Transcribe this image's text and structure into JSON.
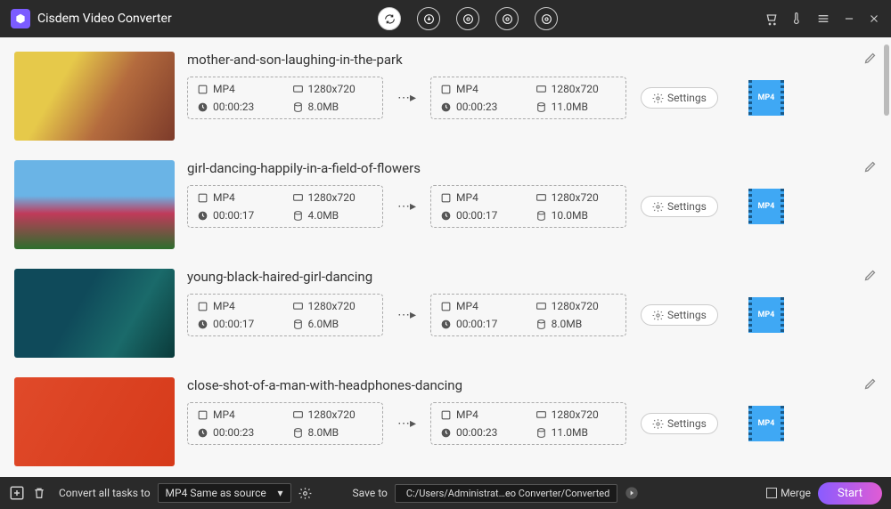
{
  "appTitle": "Cisdem Video Converter",
  "settingsLabel": "Settings",
  "formatBadge": "MP4",
  "items": [
    {
      "title": "mother-and-son-laughing-in-the-park",
      "src": {
        "format": "MP4",
        "res": "1280x720",
        "dur": "00:00:23",
        "size": "8.0MB"
      },
      "dst": {
        "format": "MP4",
        "res": "1280x720",
        "dur": "00:00:23",
        "size": "11.0MB"
      }
    },
    {
      "title": "girl-dancing-happily-in-a-field-of-flowers",
      "src": {
        "format": "MP4",
        "res": "1280x720",
        "dur": "00:00:17",
        "size": "4.0MB"
      },
      "dst": {
        "format": "MP4",
        "res": "1280x720",
        "dur": "00:00:17",
        "size": "10.0MB"
      }
    },
    {
      "title": "young-black-haired-girl-dancing",
      "src": {
        "format": "MP4",
        "res": "1280x720",
        "dur": "00:00:17",
        "size": "6.0MB"
      },
      "dst": {
        "format": "MP4",
        "res": "1280x720",
        "dur": "00:00:17",
        "size": "8.0MB"
      }
    },
    {
      "title": "close-shot-of-a-man-with-headphones-dancing",
      "src": {
        "format": "MP4",
        "res": "1280x720",
        "dur": "00:00:23",
        "size": "8.0MB"
      },
      "dst": {
        "format": "MP4",
        "res": "1280x720",
        "dur": "00:00:23",
        "size": "11.0MB"
      }
    }
  ],
  "bottom": {
    "convertLabel": "Convert all tasks to",
    "formatSelect": "MP4 Same as source",
    "saveToLabel": "Save to",
    "savePath": "C:/Users/Administrat…eo Converter/Converted",
    "mergeLabel": "Merge",
    "startLabel": "Start"
  }
}
